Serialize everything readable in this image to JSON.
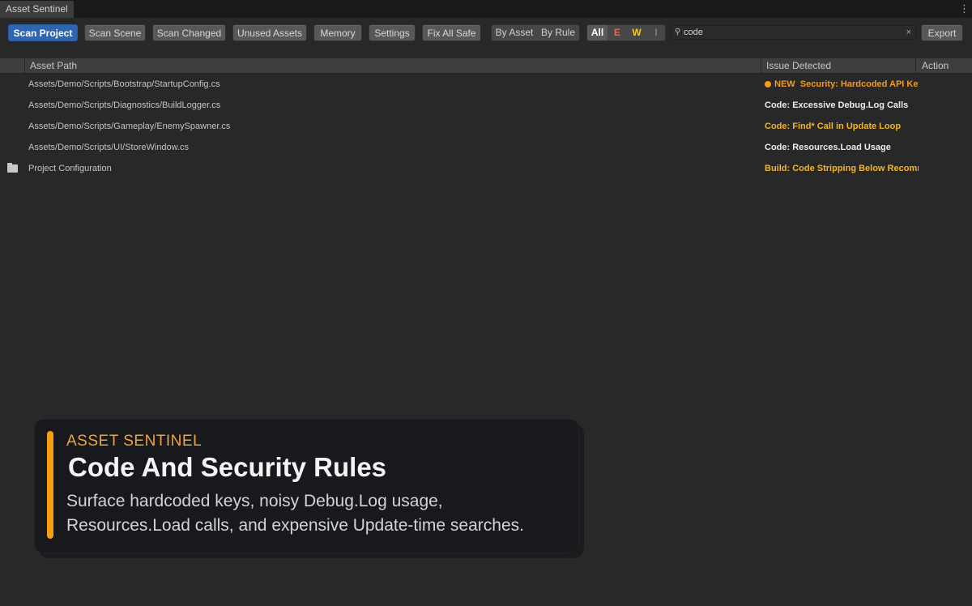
{
  "window": {
    "tab_title": "Asset Sentinel",
    "menu_icon": "kebab-menu-icon"
  },
  "toolbar": {
    "scan_project": "Scan Project",
    "scan_scene": "Scan Scene",
    "scan_changed": "Scan Changed",
    "unused_assets": "Unused Assets",
    "memory": "Memory",
    "settings": "Settings",
    "fix_all_safe": "Fix All Safe",
    "group_by": [
      "By Asset",
      "By Rule"
    ],
    "severity_filters": [
      "All",
      "E",
      "W",
      "I"
    ],
    "search": {
      "value": "code",
      "icon": "search-icon",
      "clear": "×"
    },
    "export": "Export"
  },
  "table": {
    "headers": {
      "path": "Asset Path",
      "issue": "Issue Detected",
      "action": "Action"
    },
    "rows": [
      {
        "path": "Assets/Demo/Scripts/Bootstrap/StartupConfig.cs",
        "badge": "NEW",
        "issue": "Security: Hardcoded API Key",
        "severity": "warning-new"
      },
      {
        "path": "Assets/Demo/Scripts/Diagnostics/BuildLogger.cs",
        "issue": "Code: Excessive Debug.Log Calls",
        "severity": "info"
      },
      {
        "path": "Assets/Demo/Scripts/Gameplay/EnemySpawner.cs",
        "issue": "Code: Find* Call in Update Loop",
        "severity": "warning"
      },
      {
        "path": "Assets/Demo/Scripts/UI/StoreWindow.cs",
        "issue": "Code: Resources.Load Usage",
        "severity": "info"
      },
      {
        "path": "Project Configuration",
        "issue": "Build: Code Stripping Below Recomm",
        "severity": "warning",
        "icon": "folder-icon"
      }
    ]
  },
  "overlay": {
    "eyebrow": "ASSET SENTINEL",
    "title": "Code And Security Rules",
    "description": "Surface hardcoded keys, noisy Debug.Log usage, Resources.Load calls, and expensive Update-time searches."
  },
  "colors": {
    "accent_primary": "#2f66b2",
    "warning": "#f5b422",
    "new_badge": "#f59a1c",
    "error_filter": "#ff5a4a",
    "warning_filter": "#ffc61c",
    "overlay_accent": "#f5a00f"
  }
}
